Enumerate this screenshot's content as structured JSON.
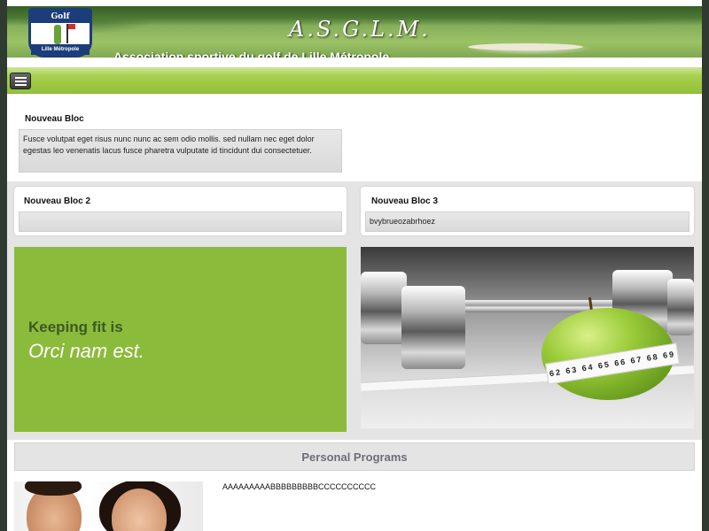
{
  "header": {
    "logo_top": "Golf",
    "logo_bottom": "Lille Métropole",
    "title": "A.S.G.L.M.",
    "subtitle": "Association sportive du golf de Lille Métropole"
  },
  "nav": {
    "menu_icon": "hamburger-menu-icon"
  },
  "bloc1": {
    "title": "Nouveau Bloc",
    "text": "Fusce volutpat eget risus nunc nunc ac sem odio mollis. sed nullam nec eget dolor egestas leo venenatis lacus fusce pharetra vulputate id tincidunt dui consectetuer."
  },
  "bloc2": {
    "title": "Nouveau Bloc 2",
    "text": ""
  },
  "bloc3": {
    "title": "Nouveau Bloc 3",
    "text": "bvybrueozabrhoez"
  },
  "promo": {
    "line1": "Keeping fit is",
    "line2": "Orci nam est."
  },
  "photo": {
    "tape_numbers": "62 63 64 65 66 67 68 69"
  },
  "programs": {
    "heading": "Personal Programs",
    "text": "AAAAAAAAABBBBBBBBBCCCCCCCCCC"
  },
  "colors": {
    "accent_green": "#8bbb3a",
    "nav_green": "#a6cf4c",
    "band_grey": "#e4e4e4"
  }
}
